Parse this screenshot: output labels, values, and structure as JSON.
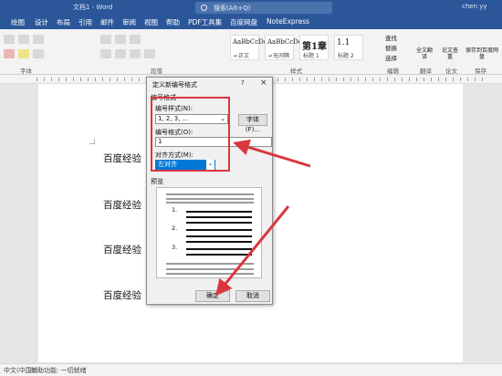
{
  "titlebar": {
    "title": "文档1 - Word",
    "search_placeholder": "搜索(Alt+Q)",
    "user": "chen yy"
  },
  "tabs": [
    "绘图",
    "设计",
    "布局",
    "引用",
    "邮件",
    "审阅",
    "视图",
    "帮助",
    "PDF工具集",
    "百度网盘",
    "NoteExpress"
  ],
  "ribbon": {
    "groups": {
      "font": "字体",
      "paragraph": "段落",
      "styles": "样式",
      "editing": "编辑",
      "translate": "翻译",
      "paper": "论文",
      "save": "保存"
    },
    "styles": [
      {
        "preview": "AaBbCcDc",
        "name": "↵正文"
      },
      {
        "preview": "AaBbCcDc",
        "name": "↵无间隔"
      },
      {
        "preview": "第1章",
        "name": "标题 1"
      },
      {
        "preview": "1.1",
        "name": "标题 2"
      }
    ],
    "find": "查找",
    "replace": "替换",
    "select": "选择",
    "translate_btn": "全文翻译",
    "paper_btn": "论文查重",
    "save_btn": "保存到百度网盘"
  },
  "document": {
    "lines": [
      "百度经验",
      "百度经验",
      "百度经验",
      "百度经验"
    ]
  },
  "dialog": {
    "title": "定义新编号格式",
    "help": "?",
    "close": "×",
    "section_label": "编号格式",
    "style_label": "编号样式(N):",
    "style_value": "1, 2, 3, ...",
    "font_button": "字体(F)...",
    "format_label": "编号格式(O):",
    "format_value": "1",
    "align_label": "对齐方式(M):",
    "align_value": "左对齐",
    "preview_label": "预览",
    "preview_numbers": [
      "1.",
      "2.",
      "3."
    ],
    "ok": "确定",
    "cancel": "取消"
  },
  "status": {
    "lang": "中文(中国)",
    "accessibility": "辅助功能: 一切就绪"
  },
  "colors": {
    "accent": "#2b579a",
    "highlight": "#d9363e"
  }
}
